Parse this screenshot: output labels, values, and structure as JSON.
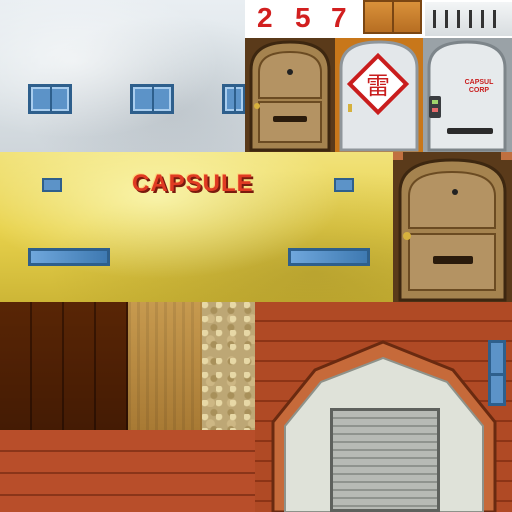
{
  "atlas": {
    "digits": [
      "2",
      "5",
      "7"
    ],
    "capsule_sign": "CAPSULE",
    "door_emblem_glyph": "雷",
    "door_metal_label_line1": "CAPSUL",
    "door_metal_label_line2": "CORP"
  },
  "colors": {
    "digit_red": "#d21f1f",
    "capsule_red": "#e03a22",
    "wall_white": "#e3e9ed",
    "wall_yellow": "#e8d24c",
    "barn_red": "#b04a25",
    "window_blue": "#5c93c8"
  }
}
